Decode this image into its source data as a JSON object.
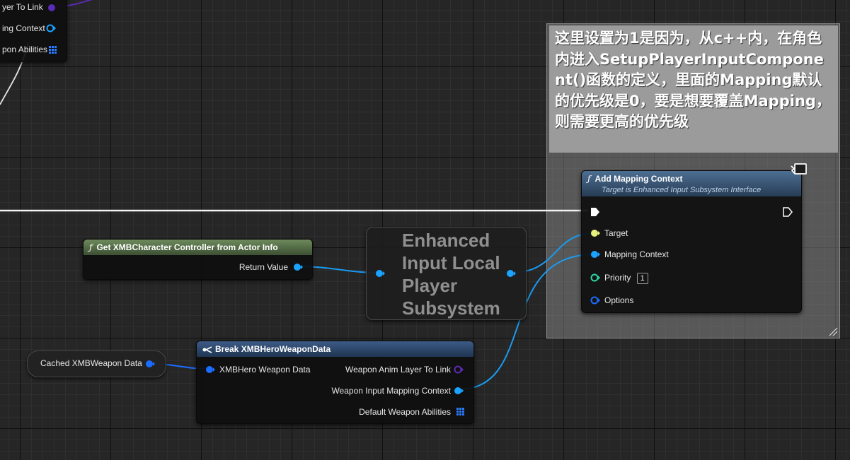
{
  "comment": {
    "text": "这里设置为1是因为，从c++内，在角色内进入SetupPlayerInputComponent()函数的定义，里面的Mapping默认的优先级是0，要是想要覆盖Mapping，则需要更高的优先级"
  },
  "top_left_node": {
    "pins": [
      "yer To Link",
      "ing Context",
      "pon Abilities"
    ]
  },
  "get_controller_node": {
    "title": "Get XMBCharacter Controller from Actor Info",
    "return_label": "Return Value"
  },
  "subsystem_node": {
    "title": "Enhanced Input Local Player Subsystem"
  },
  "add_mapping_node": {
    "title": "Add Mapping Context",
    "subtitle": "Target is Enhanced Input Subsystem Interface",
    "target_label": "Target",
    "mapping_label": "Mapping Context",
    "priority_label": "Priority",
    "priority_value": "1",
    "options_label": "Options"
  },
  "cached_var_node": {
    "label": "Cached XMBWeapon Data"
  },
  "break_node": {
    "title": "Break XMBHeroWeaponData",
    "input_label": "XMBHero Weapon Data",
    "out_anim_layer": "Weapon Anim Layer To Link",
    "out_mapping": "Weapon Input Mapping Context",
    "out_abilities": "Default Weapon Abilities"
  },
  "colors": {
    "object_pin": "#1aa3ff",
    "struct_pin": "#1a6dff",
    "class_pin": "#5a2bb5",
    "bool_pin": "#e6f07a",
    "int_pin": "#2ed3a4",
    "exec_pin": "#ffffff"
  }
}
